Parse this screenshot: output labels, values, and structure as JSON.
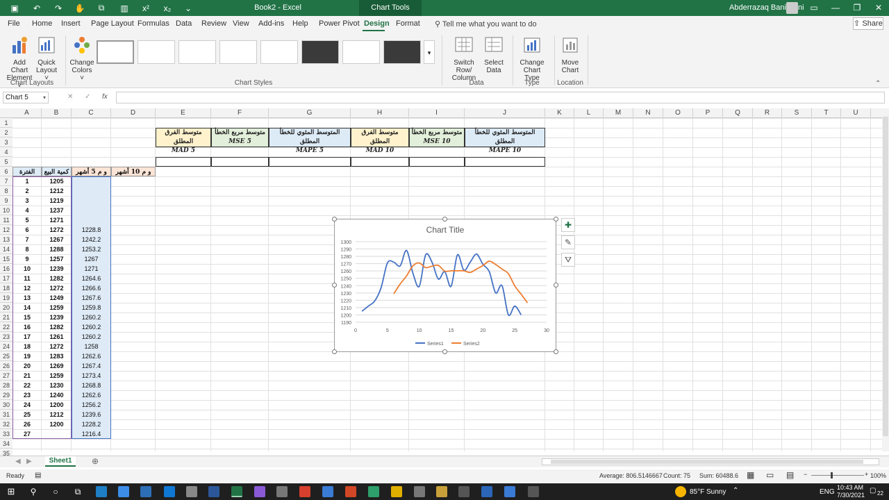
{
  "titlebar": {
    "doc_title": "Book2  -  Excel",
    "context_title": "Chart Tools",
    "user_name": "Abderrazaq Bani Hani"
  },
  "tabs": [
    "File",
    "Home",
    "Insert",
    "Page Layout",
    "Formulas",
    "Data",
    "Review",
    "View",
    "Add-ins",
    "Help",
    "Power Pivot",
    "Design",
    "Format"
  ],
  "tell_me": "Tell me what you want to do",
  "share": "Share",
  "ribbon": {
    "add_chart_element": [
      "Add Chart",
      "Element ˅"
    ],
    "quick_layout": [
      "Quick",
      "Layout ˅"
    ],
    "chart_layouts": "Chart Layouts",
    "change_colors": [
      "Change",
      "Colors ˅"
    ],
    "chart_styles": "Chart Styles",
    "switch_row_column": [
      "Switch Row/",
      "Column"
    ],
    "select_data": [
      "Select",
      "Data"
    ],
    "data_group": "Data",
    "change_chart_type": [
      "Change",
      "Chart Type"
    ],
    "type_group": "Type",
    "move_chart": [
      "Move",
      "Chart"
    ],
    "location_group": "Location"
  },
  "namebox": "Chart 5",
  "columns": [
    "A",
    "B",
    "C",
    "D",
    "E",
    "F",
    "G",
    "H",
    "I",
    "J",
    "K",
    "L",
    "M",
    "N",
    "O",
    "P",
    "Q",
    "R",
    "S",
    "T",
    "U"
  ],
  "rows": [
    "1",
    "2",
    "3",
    "4",
    "5",
    "6",
    "7",
    "8",
    "9",
    "10",
    "11",
    "12",
    "13",
    "14",
    "15",
    "16",
    "17",
    "18",
    "19",
    "20",
    "21",
    "22",
    "23",
    "24",
    "25",
    "26",
    "27",
    "28",
    "29",
    "30",
    "31",
    "32",
    "33",
    "34",
    "35"
  ],
  "headers_row2": {
    "E": "متوسط الفرق المطلق",
    "F": "متوسط مربع الخطأ",
    "G": "المتوسط المئوي للخطأ المطلق",
    "H": "متوسط الفرق المطلق",
    "I": "متوسط مربع الخطأ",
    "J": "المتوسط المئوي للخطأ المطلق"
  },
  "headers_row3": {
    "E": "MAD  5",
    "F": "MSE  5",
    "G": "MAPE  5",
    "H": "MAD  10",
    "I": "MSE  10",
    "J": "MAPE  10"
  },
  "table_headers": {
    "A": "الفترة",
    "B": "كمية البيع",
    "C": "و م 5 أشهر",
    "D": "و م 10 أشهر"
  },
  "period": [
    "1",
    "2",
    "3",
    "4",
    "5",
    "6",
    "7",
    "8",
    "9",
    "10",
    "11",
    "12",
    "13",
    "14",
    "15",
    "16",
    "17",
    "18",
    "19",
    "20",
    "21",
    "22",
    "23",
    "24",
    "25",
    "26",
    "27"
  ],
  "sales": [
    "1205",
    "1212",
    "1219",
    "1237",
    "1271",
    "1272",
    "1267",
    "1288",
    "1257",
    "1239",
    "1282",
    "1272",
    "1249",
    "1259",
    "1239",
    "1282",
    "1261",
    "1272",
    "1283",
    "1269",
    "1259",
    "1230",
    "1240",
    "1200",
    "1212",
    "1200",
    ""
  ],
  "ma5": [
    "",
    "",
    "",
    "",
    "",
    "1228.8",
    "1242.2",
    "1253.2",
    "1267",
    "1271",
    "1264.6",
    "1266.6",
    "1267.6",
    "1259.8",
    "1260.2",
    "1260.2",
    "1260.2",
    "1258",
    "1262.6",
    "1267.4",
    "1273.4",
    "1268.8",
    "1262.6",
    "1256.2",
    "1239.6",
    "1228.2",
    "1216.4"
  ],
  "chart_data": {
    "type": "line",
    "title": "Chart Title",
    "xlim": [
      0,
      30
    ],
    "ylim": [
      1190,
      1300
    ],
    "xticks": [
      "0",
      "5",
      "10",
      "15",
      "20",
      "25",
      "30"
    ],
    "yticks": [
      "1190",
      "1200",
      "1210",
      "1220",
      "1230",
      "1240",
      "1250",
      "1260",
      "1270",
      "1280",
      "1290",
      "1300"
    ],
    "grid": true,
    "legend": "bottom",
    "series": [
      {
        "name": "Series1",
        "color": "#4472c4",
        "x": [
          1,
          2,
          3,
          4,
          5,
          6,
          7,
          8,
          9,
          10,
          11,
          12,
          13,
          14,
          15,
          16,
          17,
          18,
          19,
          20,
          21,
          22,
          23,
          24,
          25,
          26
        ],
        "values": [
          1205,
          1212,
          1219,
          1237,
          1271,
          1272,
          1267,
          1288,
          1257,
          1239,
          1282,
          1272,
          1249,
          1259,
          1239,
          1282,
          1261,
          1272,
          1283,
          1269,
          1259,
          1230,
          1240,
          1200,
          1212,
          1200
        ]
      },
      {
        "name": "Series2",
        "color": "#ed7d31",
        "x": [
          6,
          7,
          8,
          9,
          10,
          11,
          12,
          13,
          14,
          15,
          16,
          17,
          18,
          19,
          20,
          21,
          22,
          23,
          24,
          25,
          26,
          27
        ],
        "values": [
          1228.8,
          1242.2,
          1253.2,
          1267,
          1271,
          1264.6,
          1266.6,
          1267.6,
          1259.8,
          1260.2,
          1260.2,
          1260.2,
          1258,
          1262.6,
          1267.4,
          1273.4,
          1268.8,
          1262.6,
          1256.2,
          1239.6,
          1228.2,
          1216.4
        ]
      }
    ]
  },
  "sheet_tab": "Sheet1",
  "status": {
    "ready": "Ready",
    "average": "Average: 806.5146667",
    "count": "Count: 75",
    "sum": "Sum: 60488.6",
    "zoom": "100%"
  },
  "taskbar": {
    "weather": "85°F  Sunny",
    "lang": "ENG",
    "time": "10:43 AM",
    "date": "7/30/2021",
    "notifications": "22"
  }
}
